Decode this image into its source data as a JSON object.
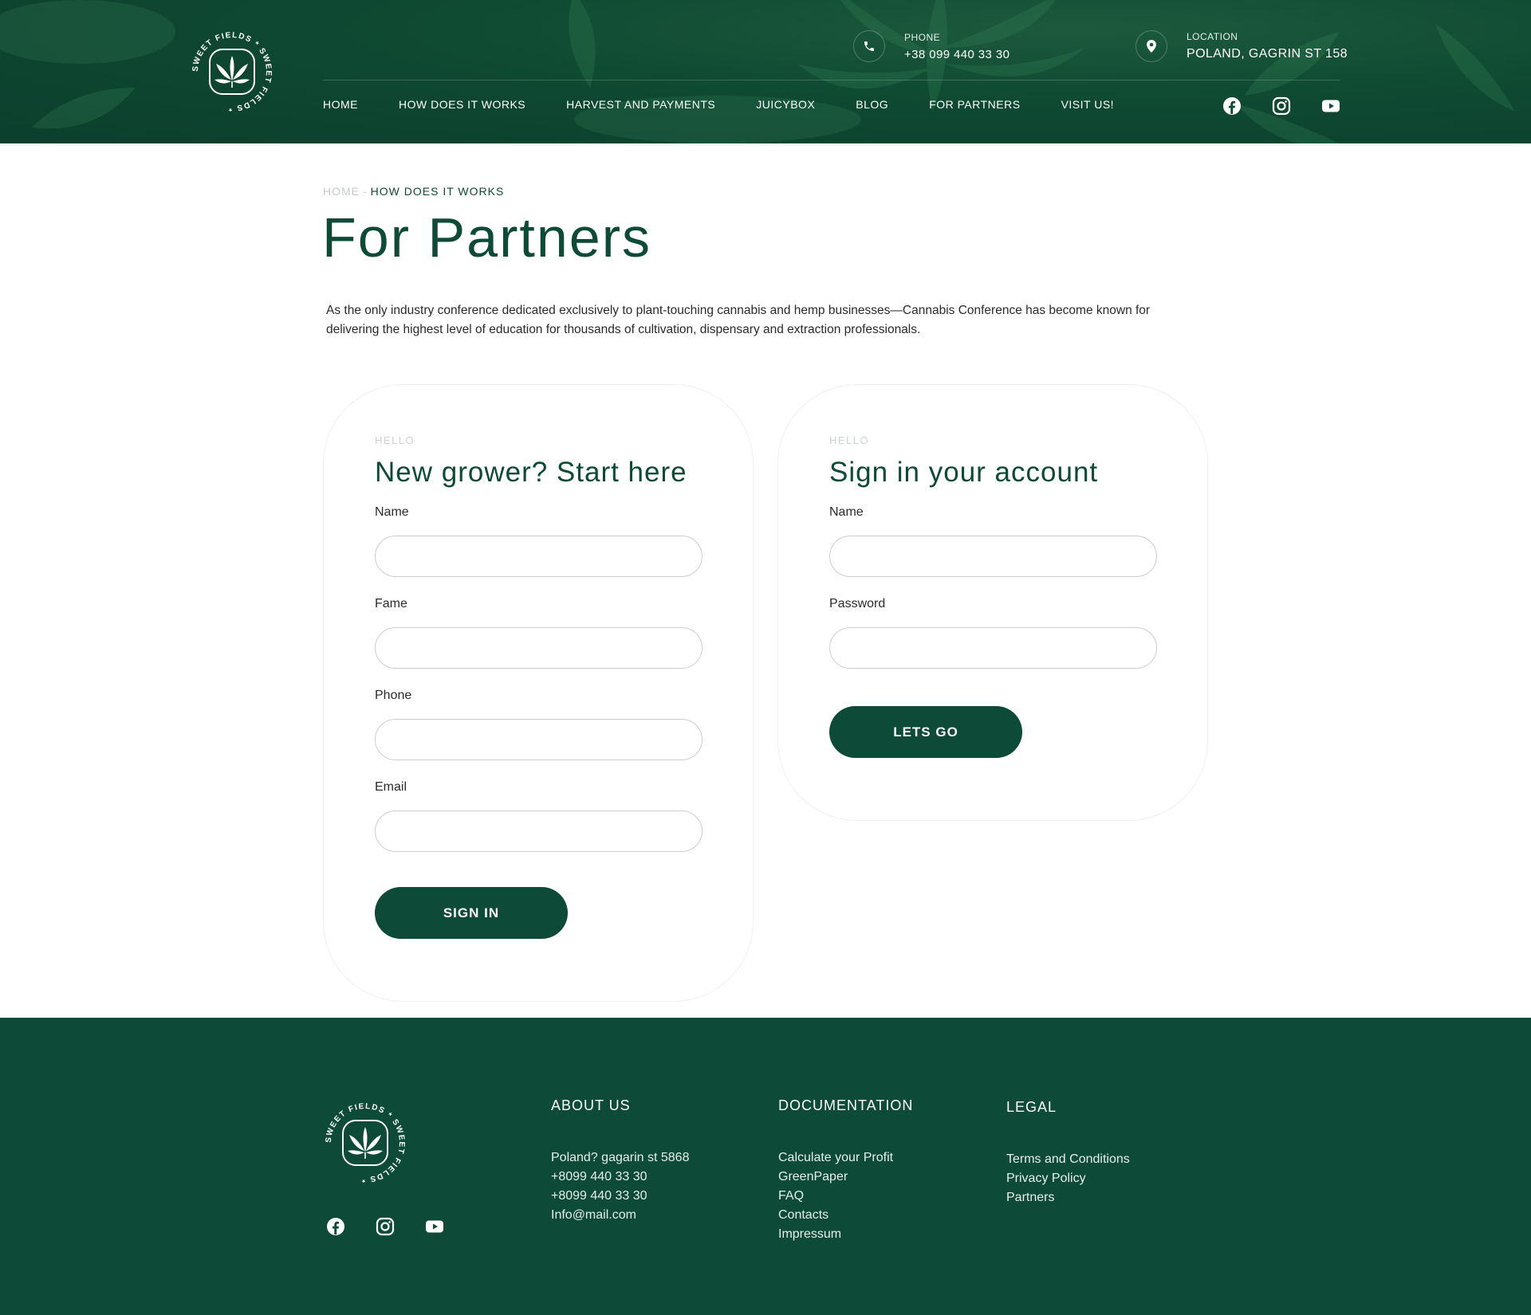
{
  "brand": {
    "logo_text": "SWEET FIELDS * SWEET FIELDS *"
  },
  "header": {
    "phone": {
      "label": "PHONE",
      "value": "+38 099 440 33 30"
    },
    "location": {
      "label": "LOCATION",
      "value": "POLAND, GAGRIN ST 158"
    },
    "nav": [
      "HOME",
      "HOW DOES IT WORKS",
      "HARVEST AND PAYMENTS",
      "JUICYBOX",
      "BLOG",
      "FOR PARTNERS",
      "VISIT US!"
    ],
    "social_icons": [
      "facebook-icon",
      "instagram-icon",
      "youtube-icon"
    ]
  },
  "breadcrumb": {
    "home": "HOME",
    "separator": "-",
    "current": "HOW DOES IT WORKS"
  },
  "page": {
    "title": "For Partners",
    "intro": "As the only industry conference dedicated exclusively to plant-touching cannabis and hemp businesses—Cannabis Conference has become known for delivering the highest level of education for thousands of cultivation, dispensary and extraction professionals."
  },
  "register_card": {
    "eyebrow": "HELLO",
    "title": "New grower? Start here",
    "fields": {
      "name": "Name",
      "fame": "Fame",
      "phone": "Phone",
      "email": "Email"
    },
    "button": "SIGN IN"
  },
  "signin_card": {
    "eyebrow": "HELLO",
    "title": "Sign in your account",
    "fields": {
      "name": "Name",
      "password": "Password"
    },
    "button": "LETS GO"
  },
  "footer": {
    "about": {
      "title": "ABOUT US",
      "items": [
        "Poland? gagarin st 5868",
        "+8099 440 33 30",
        "+8099 440 33 30",
        "Info@mail.com"
      ]
    },
    "documentation": {
      "title": "DOCUMENTATION",
      "items": [
        "Calculate your Profit",
        "GreenPaper",
        "FAQ",
        "Contacts",
        "Impressum"
      ]
    },
    "legal": {
      "title": "LEGAL",
      "items": [
        "Terms and Conditions",
        "Privacy Policy",
        "Partners"
      ]
    }
  },
  "colors": {
    "brand_green": "#0d4a37",
    "header_green": "#0f4a33",
    "muted": "#c4cbc8"
  }
}
